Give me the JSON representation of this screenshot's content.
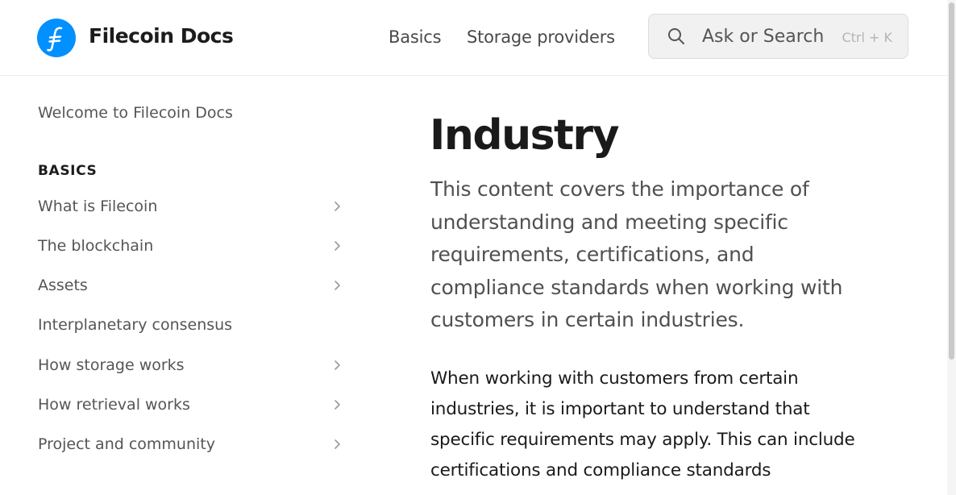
{
  "header": {
    "site_title": "Filecoin Docs",
    "logo_icon": "filecoin-f-icon",
    "brand_color": "#0090ff",
    "nav": [
      {
        "label": "Basics"
      },
      {
        "label": "Storage providers"
      }
    ],
    "search": {
      "placeholder": "Ask or Search",
      "shortcut": "Ctrl + K",
      "icon": "search-icon"
    }
  },
  "sidebar": {
    "welcome": "Welcome to Filecoin Docs",
    "section_heading": "BASICS",
    "items": [
      {
        "label": "What is Filecoin",
        "has_children": true
      },
      {
        "label": "The blockchain",
        "has_children": true
      },
      {
        "label": "Assets",
        "has_children": true
      },
      {
        "label": "Interplanetary consensus",
        "has_children": false
      },
      {
        "label": "How storage works",
        "has_children": true
      },
      {
        "label": "How retrieval works",
        "has_children": true
      },
      {
        "label": "Project and community",
        "has_children": true
      }
    ]
  },
  "main": {
    "title": "Industry",
    "lead": "This content covers the importance of understanding and meeting specific requirements, certifications, and compliance standards when working with customers in certain industries.",
    "body": "When working with customers from certain industries, it is important to understand that specific requirements may apply. This can include certifications and compliance standards"
  }
}
